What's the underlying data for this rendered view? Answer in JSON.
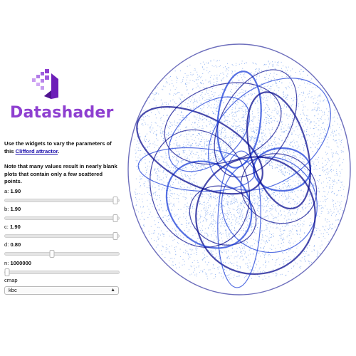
{
  "brand": {
    "name": "Datashader",
    "color": "#8e3fd0"
  },
  "description": {
    "line1_prefix": "Use the widgets to vary the parameters of this ",
    "link": "Clifford attractor",
    "line1_suffix": ".",
    "line2": "Note that many values result in nearly blank plots that contain only a few scattered points."
  },
  "widgets": [
    {
      "label": "a",
      "value": "1.90",
      "level": 0.97
    },
    {
      "label": "b",
      "value": "1.90",
      "level": 0.97
    },
    {
      "label": "c",
      "value": "1.90",
      "level": 0.97
    },
    {
      "label": "d",
      "value": "0.80",
      "level": 0.41
    },
    {
      "label": "n",
      "value": "1000000",
      "level": 0.02
    }
  ],
  "cmap": {
    "label": "cmap",
    "value": "kbc"
  },
  "plot": {
    "colormap_dark": "#0b0e8f",
    "colormap_mid": "#1c3fd8",
    "colormap_light": "#8fb2f2"
  }
}
